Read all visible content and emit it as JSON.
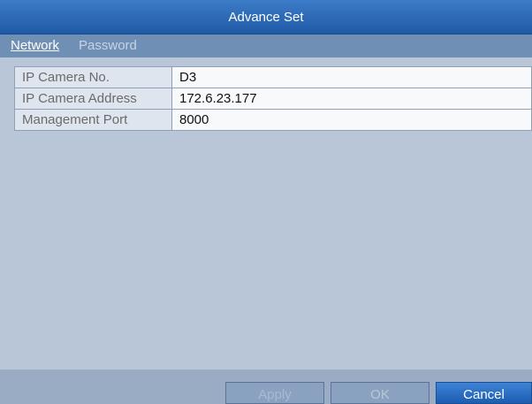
{
  "dialog": {
    "title": "Advance Set"
  },
  "tabs": [
    {
      "label": "Network",
      "active": true
    },
    {
      "label": "Password",
      "active": false
    }
  ],
  "fields": [
    {
      "label": "IP Camera No.",
      "value": "D3"
    },
    {
      "label": "IP Camera Address",
      "value": "172.6.23.177"
    },
    {
      "label": "Management Port",
      "value": "8000"
    }
  ],
  "buttons": {
    "apply": "Apply",
    "ok": "OK",
    "cancel": "Cancel"
  },
  "colors": {
    "titlebar": "#1f5aa6",
    "background": "#b8c6d8",
    "accent": "#1b5db0"
  }
}
